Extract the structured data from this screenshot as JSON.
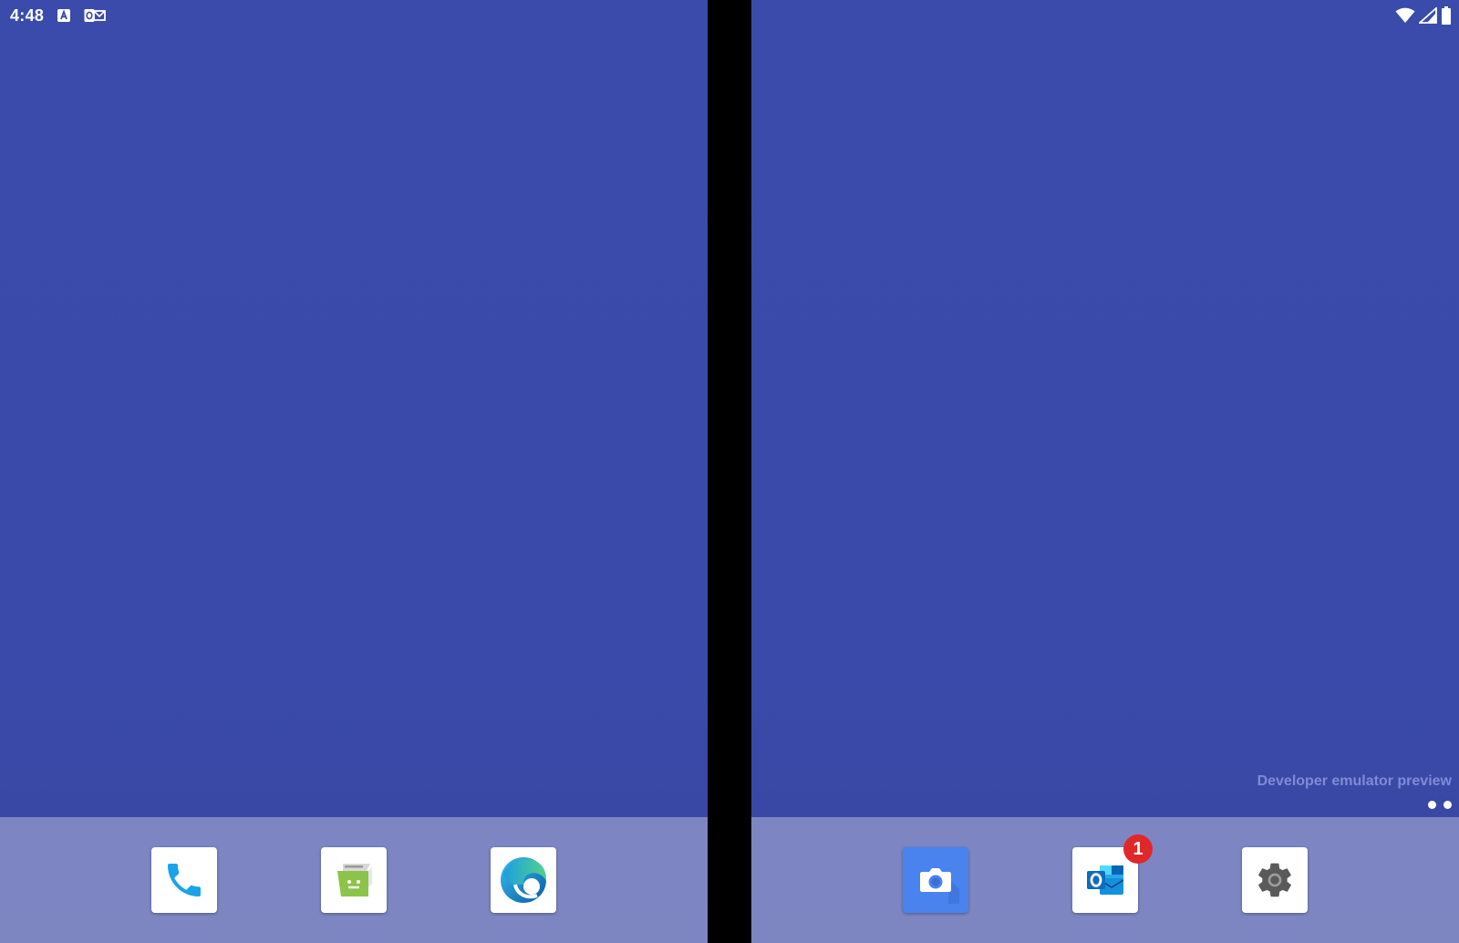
{
  "status_bar": {
    "time": "4:48",
    "notification_icons": [
      "translate-a-icon",
      "outlook-notification-icon"
    ],
    "system_icons": [
      "wifi-icon",
      "cell-signal-icon",
      "battery-icon"
    ]
  },
  "left_screen": {
    "dock": [
      {
        "name": "phone",
        "icon": "phone-icon",
        "accent": "#1aa3e8"
      },
      {
        "name": "messages",
        "icon": "messages-icon",
        "accent": "#8cc44a"
      },
      {
        "name": "edge",
        "icon": "edge-icon",
        "accent": "#0f6fc6"
      }
    ]
  },
  "right_screen": {
    "watermark": "Developer emulator preview",
    "page_count": 2,
    "dock": [
      {
        "name": "camera",
        "icon": "camera-icon",
        "accent": "#4a82ee"
      },
      {
        "name": "outlook",
        "icon": "outlook-icon",
        "accent": "#0a64c8",
        "badge": "1"
      },
      {
        "name": "settings",
        "icon": "settings-gear-icon",
        "accent": "#555555"
      }
    ]
  },
  "colors": {
    "wallpaper": "#3a4bab",
    "dock": "#8188bd",
    "badge": "#e0282a",
    "watermark_text": "#7f8bd6"
  }
}
